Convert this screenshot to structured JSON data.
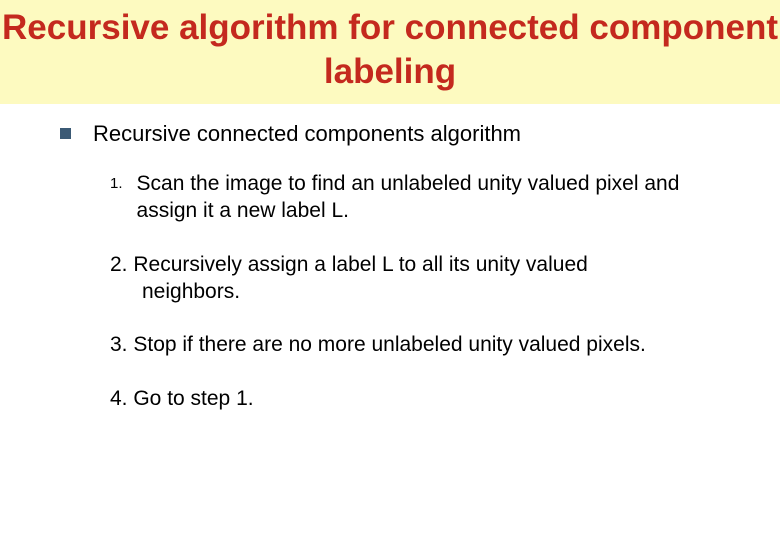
{
  "title": "Recursive algorithm for connected component labeling",
  "heading": "Recursive connected components algorithm",
  "steps": {
    "s1_num": "1.",
    "s1_text": "Scan the image to find an unlabeled unity valued pixel and assign it a new label L.",
    "s2_line1": "2. Recursively assign a label L to all its unity valued",
    "s2_line2": "neighbors.",
    "s3": "3. Stop if there are no more unlabeled unity valued pixels.",
    "s4": "4. Go to step 1."
  }
}
